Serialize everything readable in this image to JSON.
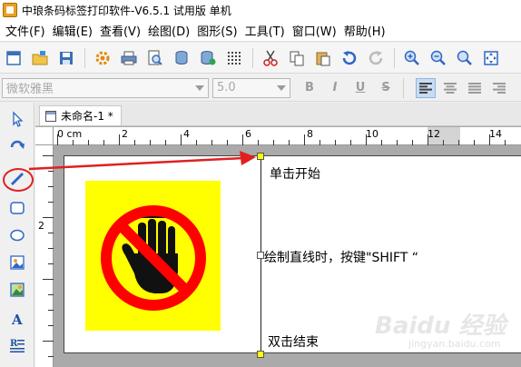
{
  "window": {
    "title": "中琅条码标签打印软件-V6.5.1 试用版 单机",
    "app_icon": "app-logo-icon"
  },
  "menu": [
    {
      "label": "文件(F)"
    },
    {
      "label": "编辑(E)"
    },
    {
      "label": "查看(V)"
    },
    {
      "label": "绘图(D)"
    },
    {
      "label": "图形(S)"
    },
    {
      "label": "工具(T)"
    },
    {
      "label": "窗口(W)"
    },
    {
      "label": "帮助(H)"
    }
  ],
  "toolbar": {
    "icons": [
      "new-icon",
      "open-icon",
      "save-icon",
      "settings-icon",
      "print-icon",
      "print-preview-icon",
      "database-icon",
      "database-settings-icon",
      "grid-icon",
      "cut-icon",
      "copy-icon",
      "paste-icon",
      "undo-icon",
      "redo-icon",
      "zoom-in-icon",
      "zoom-out-icon",
      "zoom-fit-icon",
      "fit-page-icon"
    ]
  },
  "format_bar": {
    "font_name": "微软雅黑",
    "font_size": "5.0",
    "bold": "B",
    "italic": "I",
    "underline": "U",
    "strike": "S",
    "align_active": "left"
  },
  "tools": [
    "pointer-icon",
    "rotate-icon",
    "line-icon",
    "rounded-rect-icon",
    "ellipse-icon",
    "image-icon",
    "picture-icon",
    "text-icon",
    "rich-text-icon"
  ],
  "document": {
    "tab_label": "未命名-1 *",
    "ruler_unit": "0 cm",
    "ruler_labels": [
      "2",
      "4",
      "6",
      "8",
      "10",
      "12",
      "14"
    ],
    "vruler_labels": [
      "2"
    ]
  },
  "annotations": {
    "start": "单击开始",
    "shift": "绘制直线时，按键\"SHIFT “",
    "end": "双击结束"
  },
  "colors": {
    "accent_red": "#e02020",
    "sign_yellow": "#ffff00"
  },
  "watermark": {
    "main": "Baidu 经验",
    "sub": "jingyan.baidu.com"
  }
}
